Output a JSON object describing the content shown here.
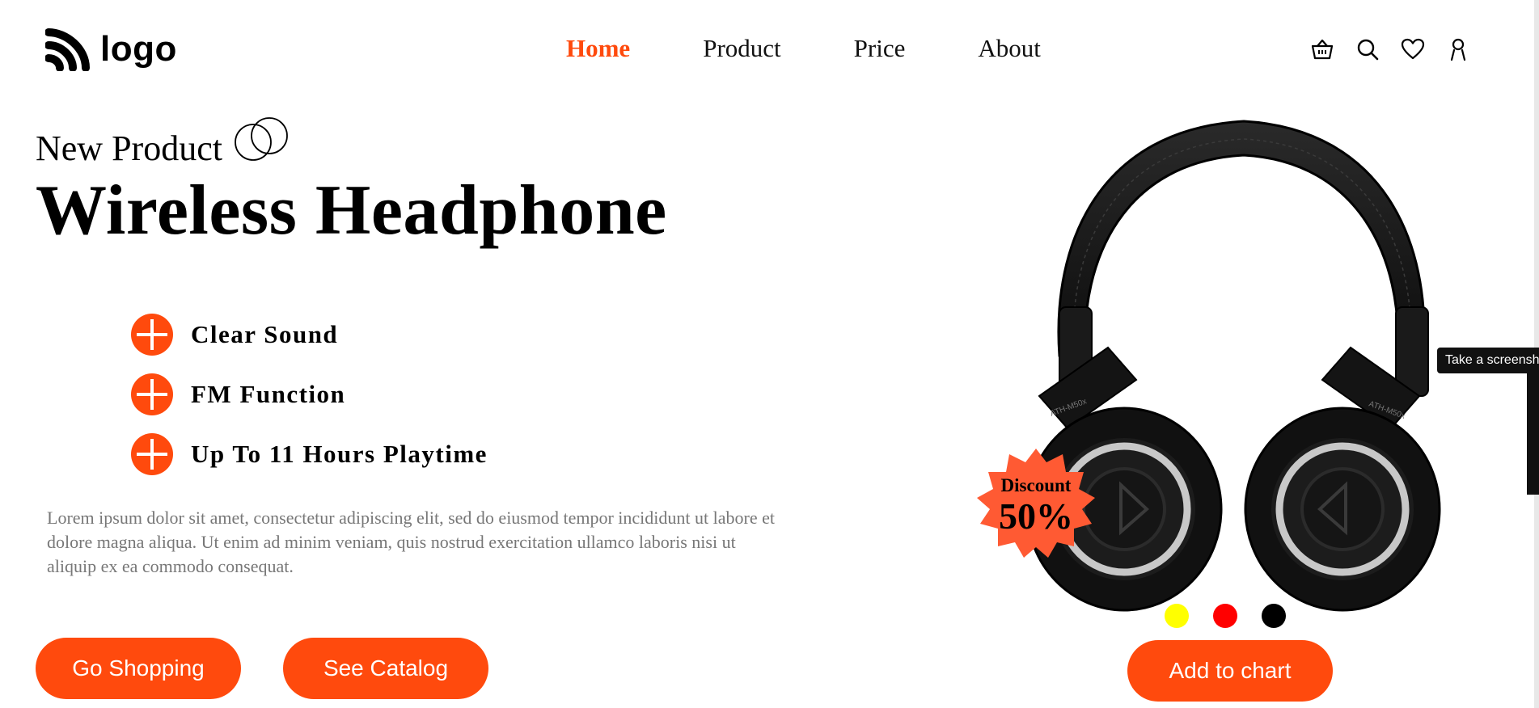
{
  "header": {
    "logo_text": "logo",
    "nav": [
      {
        "label": "Home",
        "active": true
      },
      {
        "label": "Product",
        "active": false
      },
      {
        "label": "Price",
        "active": false
      },
      {
        "label": "About",
        "active": false
      }
    ],
    "icons": [
      "basket-icon",
      "search-icon",
      "heart-icon",
      "user-icon"
    ]
  },
  "hero": {
    "subtitle": "New Product",
    "title": "Wireless Headphone",
    "features": [
      "Clear Sound",
      "FM Function",
      "Up To 11 Hours Playtime"
    ],
    "description": "Lorem ipsum dolor sit amet, consectetur adipiscing elit, sed do eiusmod tempor incididunt ut labore et dolore magna aliqua. Ut enim ad minim veniam, quis nostrud exercitation ullamco laboris nisi ut aliquip ex ea commodo consequat.",
    "go_shopping_label": "Go Shopping",
    "see_catalog_label": "See Catalog"
  },
  "product": {
    "badge_line1": "Discount",
    "badge_line2": "50%",
    "earcup_text_left": "ATH-M50x",
    "earcup_text_right": "ATH-M50x",
    "color_options": [
      "#ffff00",
      "#ff0000",
      "#000000"
    ],
    "add_to_chart_label": "Add to chart"
  },
  "overlay": {
    "tooltip_text": "Take a screenshot"
  },
  "colors": {
    "accent": "#ff4a0d",
    "badge": "#ff5a33"
  }
}
